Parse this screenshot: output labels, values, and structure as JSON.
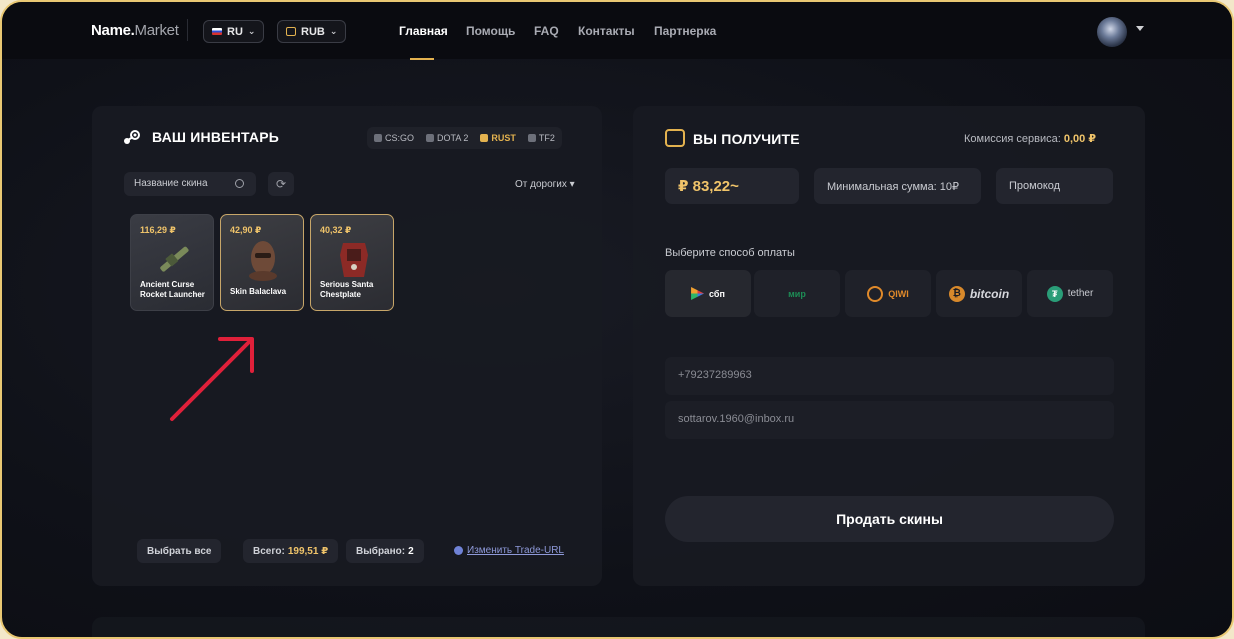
{
  "header": {
    "logo_name": "Name",
    "logo_dot": ".",
    "logo_suffix": "Market",
    "language": "RU",
    "currency": "RUB",
    "nav": [
      "Главная",
      "Помощь",
      "FAQ",
      "Контакты",
      "Партнерка"
    ],
    "active_nav": "Главная"
  },
  "inventory": {
    "title": "ВАШ ИНВЕНТАРЬ",
    "games": [
      "CS:GO",
      "DOTA 2",
      "RUST",
      "TF2"
    ],
    "active_game": "RUST",
    "search_placeholder": "Название скина",
    "sort_label": "От дорогих",
    "items": [
      {
        "price": "116,29 ₽",
        "name": "Ancient Curse Rocket Launcher",
        "selected": false
      },
      {
        "price": "42,90 ₽",
        "name": "Skin Balaclava",
        "selected": true
      },
      {
        "price": "40,32 ₽",
        "name": "Serious Santa Chestplate",
        "selected": true
      }
    ],
    "select_all": "Выбрать все",
    "total_label": "Всего:",
    "total_value": "199,51 ₽",
    "selected_label": "Выбрано:",
    "selected_value": "2",
    "trade_url_link": "Изменить Trade-URL"
  },
  "payout": {
    "title": "ВЫ ПОЛУЧИТЕ",
    "fee_label": "Комиссия сервиса:",
    "fee_value": "0,00 ₽",
    "amount": "₽ 83,22~",
    "min_sum": "Минимальная сумма: 10₽",
    "promo": "Промокод",
    "method_label": "Выберите способ оплаты",
    "methods": [
      "сбп",
      "мир",
      "QIWI",
      "bitcoin",
      "tether"
    ],
    "phone": "+79237289963",
    "email": "sottarov.1960@inbox.ru",
    "sell_button": "Продать скины"
  },
  "colors": {
    "accent": "#e3b24f",
    "price": "#f0c46a",
    "annotation_arrow": "#e0203a",
    "frame_border": "#e9c873"
  }
}
